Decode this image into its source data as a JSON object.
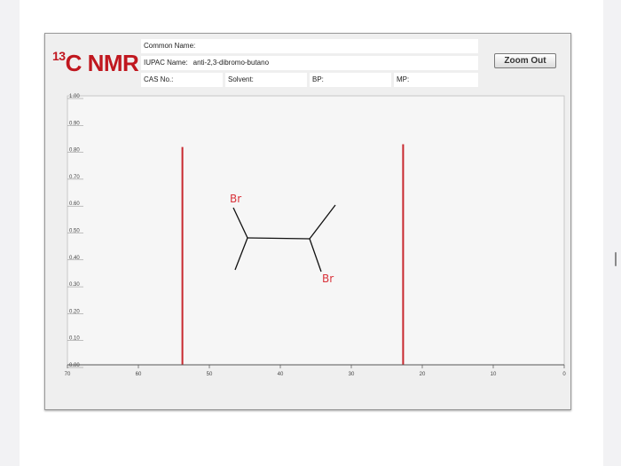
{
  "header": {
    "title_sup": "13",
    "title_main": "C NMR",
    "common_name_label": "Common Name:",
    "common_name_value": "",
    "iupac_label": "IUPAC Name:",
    "iupac_value": "anti-2,3-dibromo-butano",
    "cas_label": "CAS No.:",
    "solvent_label": "Solvent:",
    "bp_label": "BP:",
    "mp_label": "MP:",
    "zoom_out_label": "Zoom Out"
  },
  "structure_annotation": {
    "label_top": "Br",
    "label_bottom": "Br",
    "ink_color": "#d9343c"
  },
  "chart_data": {
    "type": "bar",
    "x_ticks": [
      "70",
      "60",
      "50",
      "40",
      "30",
      "20",
      "10",
      "0"
    ],
    "y_ticks": [
      "1.00",
      "0.90",
      "0.80",
      "0.70",
      "0.60",
      "0.50",
      "0.40",
      "0.30",
      "0.20",
      "0.10",
      "0.00"
    ],
    "xlim": [
      70,
      0
    ],
    "ylim": [
      0,
      1.0
    ],
    "x_reversed": true,
    "grid": false,
    "peaks": [
      {
        "x": 53.8,
        "y": 0.81
      },
      {
        "x": 22.7,
        "y": 0.82
      }
    ],
    "peak_color": "#c8282e"
  }
}
